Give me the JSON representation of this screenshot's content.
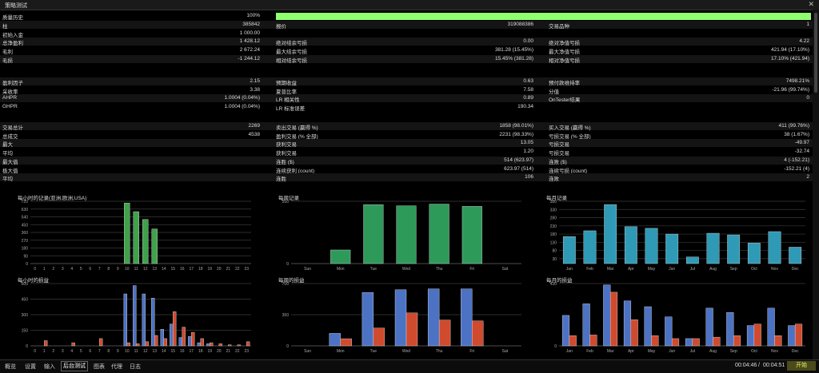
{
  "window": {
    "title": "策略测试"
  },
  "quality": {
    "label": "质量历史",
    "value": "100%"
  },
  "rows1": [
    {
      "a": "柱",
      "av": "385842",
      "b": "报价",
      "bv": "319088386",
      "c": "交易品种",
      "cv": "1"
    },
    {
      "a": "初始入金",
      "av": "1 000.00",
      "b": "",
      "bv": "",
      "c": "",
      "cv": ""
    },
    {
      "a": "总净盈利",
      "av": "1 428.12",
      "b": "绝对结余亏损",
      "bv": "0.00",
      "c": "绝对净值亏损",
      "cv": "4.22"
    },
    {
      "a": "毛利",
      "av": "2 672.24",
      "b": "最大结余亏损",
      "bv": "381.28 (15.45%)",
      "c": "最大净值亏损",
      "cv": "421.94 (17.10%)"
    },
    {
      "a": "毛损",
      "av": "-1 244.12",
      "b": "相对结余亏损",
      "bv": "15.45% (381.28)",
      "c": "相对净值亏损",
      "cv": "17.10% (421.94)"
    }
  ],
  "rows2": [
    {
      "a": "盈利因子",
      "av": "2.15",
      "b": "预期收益",
      "bv": "0.63",
      "c": "预付款维持率",
      "cv": "7498.21%"
    },
    {
      "a": "采收率",
      "av": "3.38",
      "b": "夏普比率",
      "bv": "7.58",
      "c": "分值",
      "cv": "-21.96 (99.74%)"
    },
    {
      "a": "AHPR",
      "av": "1.0004 (0.04%)",
      "b": "LR 相关性",
      "bv": "0.89",
      "c": "OnTester结果",
      "cv": "0"
    },
    {
      "a": "GHPR",
      "av": "1.0004 (0.04%)",
      "b": "LR 标准误差",
      "bv": "190.34",
      "c": "",
      "cv": ""
    }
  ],
  "rows3": [
    {
      "a": "交易总计",
      "av": "2269",
      "b": "卖出交易 (赢得 %)",
      "bv": "1858 (98.01%)",
      "c": "买入交易 (赢得 %)",
      "cv": "411 (99.76%)"
    },
    {
      "a": "总成交",
      "av": "4538",
      "b": "盈利交易 (% 全部)",
      "bv": "2231 (98.33%)",
      "c": "亏损交易 (% 全部)",
      "cv": "38 (1.67%)"
    },
    {
      "a": "最大",
      "av": "",
      "b": "获利交易",
      "bv": "13.05",
      "c": "亏损交易",
      "cv": "-49.97"
    },
    {
      "a": "平均",
      "av": "",
      "b": "获利交易",
      "bv": "1.20",
      "c": "亏损交易",
      "cv": "-32.74"
    },
    {
      "a": "最大值",
      "av": "",
      "b": "连胜 ($)",
      "bv": "514 (623.97)",
      "c": "连败 ($)",
      "cv": "4 (-152.21)"
    },
    {
      "a": "极大值",
      "av": "",
      "b": "连续获利 (count)",
      "bv": "623.97 (514)",
      "c": "连续亏损 (count)",
      "cv": "-152.21 (4)"
    },
    {
      "a": "平均",
      "av": "",
      "b": "连胜",
      "bv": "106",
      "c": "连败",
      "cv": "2"
    }
  ],
  "chart_data": [
    {
      "type": "bar",
      "title": "每小时的记录(亚洲,欧洲,USA)",
      "categories": [
        "0",
        "1",
        "2",
        "3",
        "4",
        "5",
        "6",
        "7",
        "8",
        "9",
        "10",
        "11",
        "12",
        "13",
        "14",
        "15",
        "16",
        "17",
        "18",
        "19",
        "20",
        "21",
        "22",
        "23"
      ],
      "yticks": [
        "720",
        "630",
        "540",
        "450",
        "360",
        "270",
        "180",
        "90",
        "0"
      ],
      "ylim": [
        0,
        720
      ],
      "series": [
        {
          "values": [
            0,
            0,
            0,
            0,
            0,
            0,
            0,
            0,
            0,
            0,
            700,
            600,
            510,
            400,
            0,
            0,
            0,
            0,
            0,
            0,
            0,
            0,
            0,
            0
          ],
          "color": "#3fa24a"
        }
      ]
    },
    {
      "type": "bar",
      "title": "每周记录",
      "categories": [
        "Sun",
        "Mon",
        "Tue",
        "Wed",
        "Thu",
        "Fri",
        "Sat"
      ],
      "yticks": [
        "550",
        "0"
      ],
      "ylim": [
        0,
        550
      ],
      "series": [
        {
          "values": [
            0,
            120,
            520,
            510,
            525,
            505,
            0
          ],
          "color": "#2e9a5a"
        }
      ]
    },
    {
      "type": "bar",
      "title": "每月记录",
      "categories": [
        "Jan",
        "Feb",
        "Mar",
        "Apr",
        "May",
        "Jun",
        "Jul",
        "Aug",
        "Sep",
        "Oct",
        "Nov",
        "Dec"
      ],
      "yticks": [
        "380",
        "330",
        "280",
        "230",
        "180",
        "130",
        "80",
        "30"
      ],
      "ylim": [
        0,
        380
      ],
      "series": [
        {
          "values": [
            165,
            200,
            360,
            225,
            215,
            180,
            40,
            185,
            175,
            125,
            195,
            100
          ],
          "color": "#2f9ab6"
        }
      ]
    },
    {
      "type": "bar",
      "title": "每小时的损益",
      "categories": [
        "0",
        "1",
        "2",
        "3",
        "4",
        "5",
        "6",
        "7",
        "8",
        "9",
        "10",
        "11",
        "12",
        "13",
        "14",
        "15",
        "16",
        "17",
        "18",
        "19",
        "20",
        "21",
        "22",
        "23"
      ],
      "yticks": [
        "600",
        "450",
        "300",
        "150",
        "0"
      ],
      "ylim": [
        0,
        600
      ],
      "series": [
        {
          "name": "",
          "values": [
            0,
            0,
            0,
            0,
            0,
            0,
            0,
            0,
            0,
            0,
            500,
            580,
            500,
            460,
            160,
            210,
            80,
            90,
            30,
            20,
            0,
            0,
            0,
            0
          ],
          "color": "#4c72c4"
        },
        {
          "name": "",
          "values": [
            0,
            50,
            0,
            0,
            30,
            0,
            0,
            70,
            0,
            0,
            30,
            20,
            40,
            100,
            70,
            330,
            180,
            130,
            70,
            30,
            20,
            10,
            10,
            40
          ],
          "color": "#d04a2e"
        }
      ]
    },
    {
      "type": "bar",
      "title": "每周的损益",
      "categories": [
        "Sun",
        "Mon",
        "Tue",
        "Wed",
        "Thu",
        "Fri",
        "Sat"
      ],
      "yticks": [
        "700",
        "350",
        "0"
      ],
      "ylim": [
        0,
        700
      ],
      "series": [
        {
          "name": "",
          "values": [
            0,
            140,
            600,
            630,
            640,
            640,
            0
          ],
          "color": "#4c72c4"
        },
        {
          "name": "",
          "values": [
            0,
            80,
            200,
            370,
            290,
            280,
            0
          ],
          "color": "#d04a2e"
        }
      ]
    },
    {
      "type": "bar",
      "title": "每月的损益",
      "categories": [
        "Jan",
        "Feb",
        "Mar",
        "Apr",
        "May",
        "Jun",
        "Jul",
        "Aug",
        "Sep",
        "Oct",
        "Nov",
        "Dec"
      ],
      "yticks": [
        "430",
        "0"
      ],
      "ylim": [
        0,
        430
      ],
      "series": [
        {
          "name": "",
          "values": [
            210,
            290,
            420,
            310,
            270,
            200,
            50,
            260,
            230,
            140,
            260,
            140
          ],
          "color": "#4c72c4"
        },
        {
          "name": "",
          "values": [
            70,
            75,
            370,
            180,
            70,
            50,
            50,
            60,
            70,
            150,
            70,
            150
          ],
          "color": "#d04a2e"
        }
      ]
    }
  ],
  "tabs": [
    "概览",
    "设置",
    "输入",
    "后台测试",
    "图表",
    "代理",
    "日志"
  ],
  "active_tab": "后台测试",
  "time": {
    "elapsed": "00:04:46",
    "separator": "/",
    "total": "00:04:51"
  },
  "start_button": "开始"
}
